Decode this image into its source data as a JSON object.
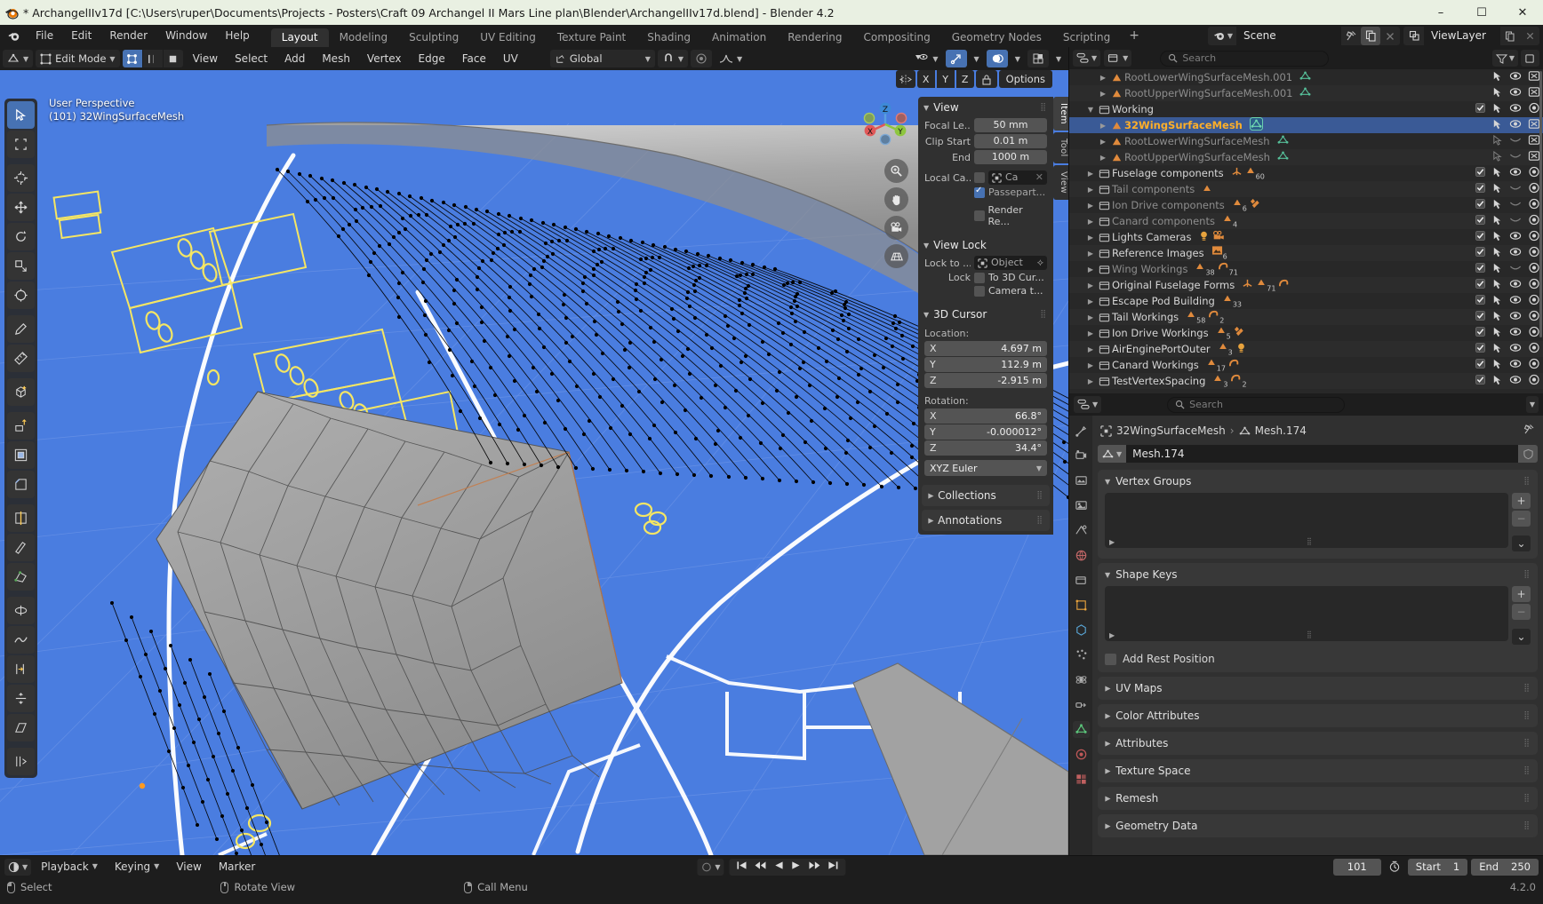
{
  "window": {
    "title": "* ArchangelIIv17d [C:\\Users\\ruper\\Documents\\Projects - Posters\\Craft 09 Archangel II Mars Line plan\\Blender\\ArchangelIIv17d.blend] - Blender 4.2",
    "minimize": "–",
    "maximize": "☐",
    "close": "✕"
  },
  "topbar": {
    "menus": [
      "File",
      "Edit",
      "Render",
      "Window",
      "Help"
    ],
    "workspaces": [
      "Layout",
      "Modeling",
      "Sculpting",
      "UV Editing",
      "Texture Paint",
      "Shading",
      "Animation",
      "Rendering",
      "Compositing",
      "Geometry Nodes",
      "Scripting"
    ],
    "active_workspace": "Layout",
    "add_workspace": "+",
    "scene_name": "Scene",
    "view_layer_name": "ViewLayer",
    "pin_icon": "pin-icon",
    "new_scene_icon": "copy-icon",
    "remove_scene_icon": "x-icon"
  },
  "viewport_header": {
    "editor_type_icon": "editor-type-icon",
    "mode": "Edit Mode",
    "select_modes": [
      "vertex-select-icon",
      "edge-select-icon",
      "face-select-icon"
    ],
    "active_select_mode": 0,
    "menus": [
      "View",
      "Select",
      "Add",
      "Mesh",
      "Vertex",
      "Edge",
      "Face",
      "UV"
    ],
    "transform_orientation": "Global",
    "snap_icon": "magnet-icon",
    "proportional_icon": "proportional-edit-icon",
    "falloff_icon": "smooth-falloff-icon",
    "visibility_icon": "visibility-icon",
    "gizmo_icon": "gizmo-icon",
    "overlay_icon": "overlays-icon",
    "xray_icon": "xray-icon",
    "shading_modes": [
      "wireframe",
      "solid",
      "material",
      "rendered"
    ],
    "active_shading": 1
  },
  "viewport": {
    "perspective_label": "User Perspective",
    "collection_label": "(101) 32WingSurfaceMesh",
    "gizmo_axes": [
      "X",
      "Y",
      "Z"
    ],
    "nav_buttons": [
      "zoom-icon",
      "pan-hand-icon",
      "camera-view-icon",
      "orthographic-toggle-icon"
    ],
    "options_label": "Options",
    "pivot_axes": [
      "X",
      "Y",
      "Z"
    ],
    "side_tabs": [
      "Item",
      "Tool",
      "View"
    ],
    "active_side_tab": "Item"
  },
  "tools": [
    {
      "name": "tweak-tool",
      "active": true
    },
    {
      "name": "select-box-tool",
      "active": false
    },
    {
      "name": "cursor-tool",
      "active": false
    },
    {
      "name": "move-tool",
      "active": false
    },
    {
      "name": "rotate-tool",
      "active": false
    },
    {
      "name": "scale-tool",
      "active": false
    },
    {
      "name": "transform-tool",
      "active": false
    },
    {
      "name": "annotate-tool",
      "active": false
    },
    {
      "name": "measure-tool",
      "active": false
    },
    {
      "name": "add-cube-tool",
      "active": false
    },
    {
      "name": "extrude-region-tool",
      "active": false
    },
    {
      "name": "inset-faces-tool",
      "active": false
    },
    {
      "name": "bevel-tool",
      "active": false
    },
    {
      "name": "loop-cut-tool",
      "active": false
    },
    {
      "name": "knife-tool",
      "active": false
    },
    {
      "name": "poly-build-tool",
      "active": false
    },
    {
      "name": "spin-tool",
      "active": false
    },
    {
      "name": "smooth-tool",
      "active": false
    },
    {
      "name": "edge-slide-tool",
      "active": false
    },
    {
      "name": "shrink-fatten-tool",
      "active": false
    },
    {
      "name": "shear-tool",
      "active": false
    },
    {
      "name": "rip-region-tool",
      "active": false
    }
  ],
  "npanel": {
    "view_panel": {
      "title": "View",
      "focal_label": "Focal Le...",
      "focal_value": "50 mm",
      "clip_start_label": "Clip Start",
      "clip_start_value": "0.01 m",
      "clip_end_label": "End",
      "clip_end_value": "1000 m",
      "local_camera_label": "Local Ca...",
      "local_camera_value": "Ca",
      "passepartout_label": "Passepart...",
      "passepartout_checked": true,
      "render_region_label": "Render Re...",
      "render_region_checked": false
    },
    "view_lock_panel": {
      "title": "View Lock",
      "lock_to_label": "Lock to ...",
      "lock_to_value": "Object",
      "lock_label": "Lock",
      "to_3d_cursor_label": "To 3D Cur...",
      "camera_to_view_label": "Camera t..."
    },
    "cursor_panel": {
      "title": "3D Cursor",
      "location_label": "Location:",
      "location": [
        {
          "axis": "X",
          "value": "4.697 m"
        },
        {
          "axis": "Y",
          "value": "112.9 m"
        },
        {
          "axis": "Z",
          "value": "-2.915 m"
        }
      ],
      "rotation_label": "Rotation:",
      "rotation": [
        {
          "axis": "X",
          "value": "66.8°"
        },
        {
          "axis": "Y",
          "value": "-0.000012°"
        },
        {
          "axis": "Z",
          "value": "34.4°"
        }
      ],
      "rotation_mode": "XYZ Euler"
    },
    "collections_panel": "Collections",
    "annotations_panel": "Annotations"
  },
  "outliner": {
    "display_mode_icon": "outliner-display-mode-icon",
    "filter_icon": "filter-icon",
    "search_placeholder": "Search",
    "new_collection_icon": "new-collection-icon",
    "rows": [
      {
        "indent": 2,
        "type": "mesh",
        "name": "RootLowerWingSurfaceMesh.001",
        "dim": true,
        "partial": true,
        "badges": [
          "mesh-data-icon"
        ],
        "tools": [
          "restrict-select",
          "hide",
          "disable-render"
        ],
        "checkbox": false
      },
      {
        "indent": 2,
        "type": "mesh",
        "name": "RootUpperWingSurfaceMesh.001",
        "dim": true,
        "badges": [
          "mesh-data-icon"
        ],
        "tools": [
          "restrict-select",
          "hide",
          "disable-render"
        ],
        "checkbox": false
      },
      {
        "indent": 1,
        "type": "collection",
        "name": "Working",
        "dim": false,
        "badges": [],
        "tools": [
          "restrict-select",
          "hide",
          "disable-render"
        ],
        "checkbox": true,
        "expanded": true
      },
      {
        "indent": 2,
        "type": "mesh",
        "name": "32WingSurfaceMesh",
        "selected": true,
        "active": true,
        "badges": [
          "mesh-data-icon-active"
        ],
        "tools": [
          "restrict-select",
          "hide",
          "disable-render"
        ],
        "checkbox": false
      },
      {
        "indent": 2,
        "type": "mesh",
        "name": "RootLowerWingSurfaceMesh",
        "dim": true,
        "badges": [
          "mesh-data-icon"
        ],
        "tools": [
          "restrict-select-off",
          "hide-off",
          "disable-render"
        ],
        "checkbox": false
      },
      {
        "indent": 2,
        "type": "mesh",
        "name": "RootUpperWingSurfaceMesh",
        "dim": true,
        "badges": [
          "mesh-data-icon"
        ],
        "tools": [
          "restrict-select-off",
          "hide-off",
          "disable-render"
        ],
        "checkbox": false
      },
      {
        "indent": 1,
        "type": "collection",
        "name": "Fuselage components",
        "badges": [
          "empty-icon",
          "mesh-icon"
        ],
        "counts": [
          "",
          "60"
        ],
        "tools": [
          "restrict-select",
          "hide",
          "disable-render"
        ],
        "checkbox": true
      },
      {
        "indent": 1,
        "type": "collection",
        "name": "Tail components",
        "dim": true,
        "badges": [
          "mesh-icon"
        ],
        "counts": [
          ""
        ],
        "tools": [
          "restrict-select",
          "hide-off",
          "disable-render"
        ],
        "checkbox": true
      },
      {
        "indent": 1,
        "type": "collection",
        "name": "Ion Drive components",
        "dim": true,
        "badges": [
          "mesh-icon",
          "material-icon"
        ],
        "counts": [
          "6",
          ""
        ],
        "tools": [
          "restrict-select",
          "hide-off",
          "disable-render"
        ],
        "checkbox": true
      },
      {
        "indent": 1,
        "type": "collection",
        "name": "Canard components",
        "dim": true,
        "badges": [
          "mesh-icon"
        ],
        "counts": [
          "4"
        ],
        "tools": [
          "restrict-select",
          "hide-off",
          "disable-render"
        ],
        "checkbox": true
      },
      {
        "indent": 1,
        "type": "collection",
        "name": "Lights Cameras",
        "badges": [
          "light-icon",
          "camera-icon"
        ],
        "counts": [
          "",
          ""
        ],
        "tools": [
          "restrict-select",
          "hide",
          "disable-render"
        ],
        "checkbox": true
      },
      {
        "indent": 1,
        "type": "collection",
        "name": "Reference Images",
        "badges": [
          "image-icon"
        ],
        "counts": [
          "6"
        ],
        "tools": [
          "restrict-select",
          "hide",
          "disable-render"
        ],
        "checkbox": true
      },
      {
        "indent": 1,
        "type": "collection",
        "name": "Wing Workings",
        "dim": true,
        "badges": [
          "mesh-icon",
          "curve-icon"
        ],
        "counts": [
          "38",
          "71"
        ],
        "tools": [
          "restrict-select",
          "hide-off",
          "disable-render"
        ],
        "checkbox": true
      },
      {
        "indent": 1,
        "type": "collection",
        "name": "Original Fuselage Forms",
        "badges": [
          "empty-icon",
          "mesh-icon",
          "curve-icon"
        ],
        "counts": [
          "",
          "71",
          ""
        ],
        "tools": [
          "restrict-select",
          "hide",
          "disable-render"
        ],
        "checkbox": true
      },
      {
        "indent": 1,
        "type": "collection",
        "name": "Escape Pod Building",
        "badges": [
          "mesh-icon"
        ],
        "counts": [
          "33"
        ],
        "tools": [
          "restrict-select",
          "hide",
          "disable-render"
        ],
        "checkbox": true
      },
      {
        "indent": 1,
        "type": "collection",
        "name": "Tail Workings",
        "badges": [
          "mesh-icon",
          "curve-icon"
        ],
        "counts": [
          "58",
          "2"
        ],
        "tools": [
          "restrict-select",
          "hide",
          "disable-render"
        ],
        "checkbox": true
      },
      {
        "indent": 1,
        "type": "collection",
        "name": "Ion Drive Workings",
        "badges": [
          "mesh-icon",
          "material-icon"
        ],
        "counts": [
          "5",
          ""
        ],
        "tools": [
          "restrict-select",
          "hide",
          "disable-render"
        ],
        "checkbox": true
      },
      {
        "indent": 1,
        "type": "collection",
        "name": "AirEnginePortOuter",
        "badges": [
          "mesh-icon",
          "light-icon"
        ],
        "counts": [
          "3",
          ""
        ],
        "tools": [
          "restrict-select",
          "hide",
          "disable-render"
        ],
        "checkbox": true
      },
      {
        "indent": 1,
        "type": "collection",
        "name": "Canard Workings",
        "badges": [
          "mesh-icon",
          "curve-icon"
        ],
        "counts": [
          "17",
          ""
        ],
        "tools": [
          "restrict-select",
          "hide",
          "disable-render"
        ],
        "checkbox": true
      },
      {
        "indent": 1,
        "type": "collection",
        "name": "TestVertexSpacing",
        "badges": [
          "mesh-icon",
          "curve-icon"
        ],
        "counts": [
          "3",
          "2"
        ],
        "tools": [
          "restrict-select",
          "hide",
          "disable-render"
        ],
        "checkbox": true
      }
    ]
  },
  "properties": {
    "editor_icon": "properties-editor-icon",
    "search_placeholder": "Search",
    "tabs": [
      "tool-tab",
      "render-tab",
      "output-tab",
      "view-layer-tab",
      "scene-tab",
      "world-tab",
      "collection-tab",
      "object-tab",
      "modifiers-tab",
      "particles-tab",
      "physics-tab",
      "constraints-tab",
      "data-tab",
      "material-tab",
      "texture-tab"
    ],
    "active_tab": "data-tab",
    "breadcrumb_object": "32WingSurfaceMesh",
    "breadcrumb_data": "Mesh.174",
    "datablock_name": "Mesh.174",
    "panels": [
      {
        "title": "Vertex Groups",
        "open": true,
        "has_list": true,
        "buttons": [
          "+",
          "−",
          "⌄"
        ]
      },
      {
        "title": "Shape Keys",
        "open": true,
        "has_list": true,
        "buttons": [
          "+",
          "−",
          "⌄"
        ],
        "checkbox_label": "Add Rest Position",
        "checkbox_checked": false
      },
      {
        "title": "UV Maps",
        "open": false
      },
      {
        "title": "Color Attributes",
        "open": false
      },
      {
        "title": "Attributes",
        "open": false
      },
      {
        "title": "Texture Space",
        "open": false
      },
      {
        "title": "Remesh",
        "open": false
      },
      {
        "title": "Geometry Data",
        "open": false
      }
    ]
  },
  "timeline": {
    "editor_icon": "timeline-editor-icon",
    "playback_label": "Playback",
    "keying_label": "Keying",
    "view_label": "View",
    "marker_label": "Marker",
    "sync_icon": "sync-icon",
    "transport": [
      "jump-start-icon",
      "prev-keyframe-icon",
      "play-reverse-icon",
      "play-icon",
      "next-keyframe-icon",
      "jump-end-icon"
    ],
    "current_frame": "101",
    "auto_key_icon": "auto-keyframe-icon",
    "start_label": "Start",
    "start_value": "1",
    "end_label": "End",
    "end_value": "250"
  },
  "statusbar": {
    "items": [
      {
        "mouse": "left",
        "label": "Select"
      },
      {
        "mouse": "middle",
        "label": "Rotate View"
      },
      {
        "mouse": "right",
        "label": "Call Menu"
      }
    ],
    "version": "4.2.0"
  },
  "colors": {
    "blueprint_blue": "#4a7de0",
    "accent_blue": "#4772b3",
    "active_orange": "#ffaf29",
    "yellow_annotation": "#f5e663",
    "gray_surface": "#9c9c9c",
    "header_dark": "#1d1d1d",
    "panel_gray": "#303030"
  }
}
